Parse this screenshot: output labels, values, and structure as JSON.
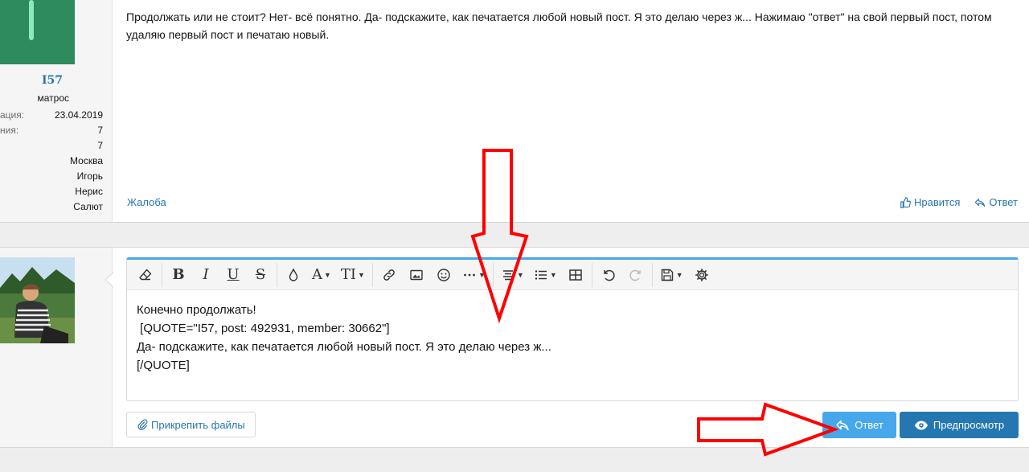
{
  "post1": {
    "user": {
      "name": "I57",
      "title": "матрос",
      "stats": [
        {
          "key": "ация:",
          "value": "23.04.2019"
        },
        {
          "key": "ния:",
          "value": "7"
        },
        {
          "key": "",
          "value": "7"
        },
        {
          "key": "",
          "value": "Москва"
        },
        {
          "key": "",
          "value": "Игорь"
        },
        {
          "key": "",
          "value": "Нерис"
        },
        {
          "key": "",
          "value": "Салют"
        }
      ]
    },
    "body": "Продолжать или не стоит? Нет- всё понятно. Да- подскажите, как печатается любой новый пост. Я это делаю через ж... Нажимаю \"ответ\" на свой первый пост, потом удаляю первый пост и печатаю новый.",
    "complaint": "Жалоба",
    "like": "Нравится",
    "reply": "Ответ"
  },
  "editor": {
    "text": "Конечно продолжать!\n [QUOTE=\"I57, post: 492931, member: 30662\"]\nДа- подскажите, как печатается любой новый пост. Я это делаю через ж...\n[/QUOTE]",
    "toolbar": {
      "bold": "B",
      "italic": "I",
      "underline": "U",
      "strike": "S",
      "font": "A",
      "size": "TI"
    }
  },
  "buttons": {
    "attach": "Прикрепить файлы",
    "reply": "Ответ",
    "preview": "Предпросмотр"
  },
  "colors": {
    "link": "#2577b1",
    "reply_button": "#47a7eb",
    "preview_button": "#2577b1",
    "annotation": "#ff0000"
  }
}
